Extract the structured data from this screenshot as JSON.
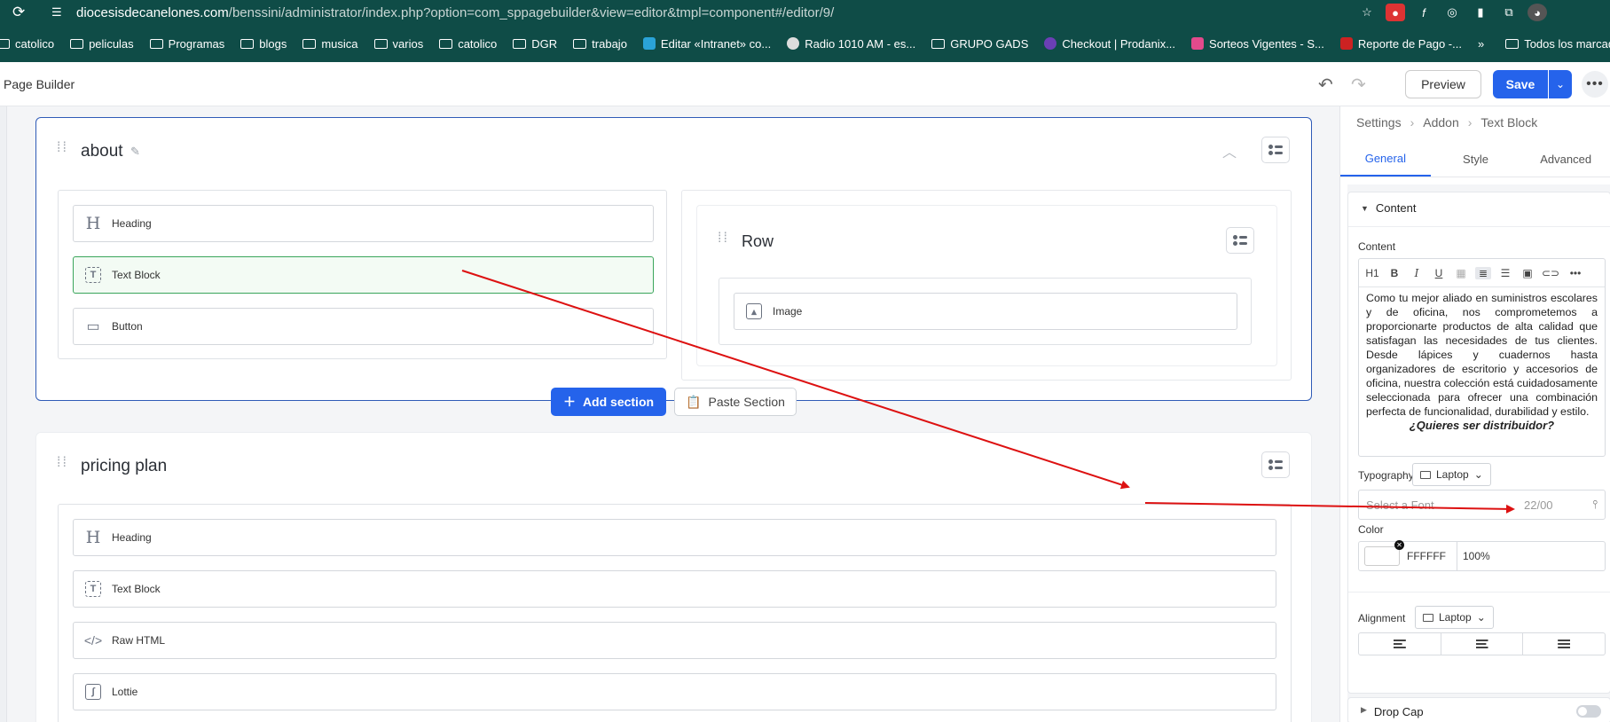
{
  "browser": {
    "url_host": "diocesisdecanelones.com",
    "url_path": "/benssini/administrator/index.php?option=com_sppagebuilder&view=editor&tmpl=component#/editor/9/",
    "bookmarks": [
      "catolico",
      "peliculas",
      "Programas",
      "blogs",
      "musica",
      "varios",
      "catolico",
      "DGR",
      "trabajo",
      "Editar «Intranet» co...",
      "Radio 1010 AM - es...",
      "GRUPO GADS",
      "Checkout | Prodanix...",
      "Sorteos Vigentes - S...",
      "Reporte de Pago -...",
      "»",
      "Todos los marcado"
    ]
  },
  "header": {
    "title": "Page Builder",
    "preview_label": "Preview",
    "save_label": "Save"
  },
  "canvas": {
    "about": {
      "title": "about",
      "left_addons": [
        "Heading",
        "Text Block",
        "Button"
      ],
      "row_title": "Row",
      "row_addon": "Image"
    },
    "add_section_label": "Add section",
    "paste_section_label": "Paste Section",
    "pricing": {
      "title": "pricing plan",
      "addons": [
        "Heading",
        "Text Block",
        "Raw HTML",
        "Lottie"
      ]
    }
  },
  "panel": {
    "crumbs": [
      "Settings",
      "Addon",
      "Text Block"
    ],
    "tabs": [
      "General",
      "Style",
      "Advanced"
    ],
    "section_title": "Content",
    "content_label": "Content",
    "toolbar": [
      "H1",
      "B",
      "I",
      "U"
    ],
    "content_text": "Como tu mejor aliado en suministros escolares y de oficina, nos comprometemos a proporcionarte productos de alta calidad que satisfagan las necesidades de tus clientes. Desde lápices y cuadernos hasta organizadores de escritorio y accesorios de oficina, nuestra colección está cuidadosamente seleccionada para ofrecer una combinación perfecta de funcionalidad, durabilidad y estilo.",
    "content_emphasis": "¿Quieres ser distribuidor?",
    "typography_label": "Typography",
    "device": "Laptop",
    "font_placeholder": "Select a Font",
    "font_size": "22/00",
    "color_label": "Color",
    "color_hex": "FFFFFF",
    "color_opacity": "100%",
    "alignment_label": "Alignment",
    "drop_cap_label": "Drop Cap"
  },
  "colors": {
    "chrome": "#0f4c47",
    "accent": "#2563eb",
    "active_addon": "#3aa55b",
    "annotation_arrow": "#dd1111"
  }
}
